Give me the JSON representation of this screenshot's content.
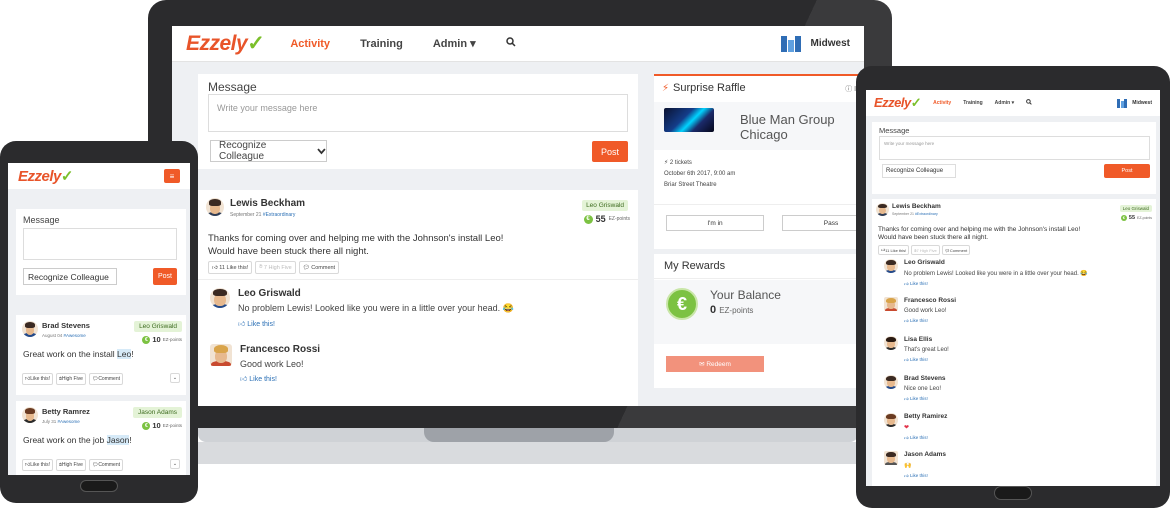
{
  "brand": {
    "logo": "Ezzely",
    "accent": "#f05a28",
    "green": "#7cc242"
  },
  "laptop": {
    "nav": {
      "items": [
        "Activity",
        "Training",
        "Admin ▾"
      ],
      "org": "Midwest"
    },
    "message": {
      "title": "Message",
      "placeholder": "Write your message here",
      "recognize": "Recognize Colleague",
      "post": "Post"
    },
    "post": {
      "author": "Lewis Beckham",
      "date": "September 21",
      "hashtag": "#Extraordinary",
      "recipient": "Leo Griswald",
      "points": "55",
      "points_unit": "EZ-points",
      "body_line1": "Thanks for coming over and helping me with the Johnson's install Leo!",
      "body_line2": "Would have been stuck there all night.",
      "actions": [
        "11 Like this!",
        "7 High Five",
        "Comment"
      ]
    },
    "replies": [
      {
        "name": "Leo Griswald",
        "text": "No problem Lewis! Looked like you were in a little over your head. 😂",
        "like": "Like this!"
      },
      {
        "name": "Francesco Rossi",
        "text": "Good work Leo!",
        "like": "Like this!"
      }
    ],
    "raffle": {
      "title": "Surprise Raffle",
      "info": "In",
      "event_line1": "Blue Man Group",
      "event_line2": "Chicago",
      "tickets": "2 tickets",
      "datetime": "October 6th 2017, 9:00 am",
      "venue": "Briar Street Theatre",
      "in_label": "I'm in",
      "pass_label": "Pass"
    },
    "rewards": {
      "title": "My Rewards",
      "balance_label": "Your Balance",
      "balance": "0",
      "unit": "EZ-points",
      "redeem": "Redeem"
    }
  },
  "phone": {
    "menu": "≡",
    "message": {
      "label": "Message",
      "recognize": "Recognize Colleague",
      "post": "Post"
    },
    "posts": [
      {
        "author": "Brad Stevens",
        "date": "August 04",
        "hashtag": "#Awesome",
        "recipient": "Leo Griswald",
        "points": "10",
        "points_unit": "EZ-points",
        "body_prefix": "Great work on the install ",
        "mention": "Leo",
        "body_suffix": "!",
        "actions": [
          "Like this!",
          "High Five",
          "Comment"
        ]
      },
      {
        "author": "Betty Ramrez",
        "date": "July 31",
        "hashtag": "#Awesome",
        "recipient": "Jason Adams",
        "points": "10",
        "points_unit": "EZ-points",
        "body_prefix": "Great work on the job ",
        "mention": "Jason",
        "body_suffix": "!",
        "actions": [
          "Like this!",
          "High Five",
          "Comment"
        ]
      }
    ]
  },
  "tablet": {
    "nav": {
      "items": [
        "Activity",
        "Training",
        "Admin ▾"
      ],
      "org": "Midwest"
    },
    "message": {
      "label": "Message",
      "placeholder": "Write your message here",
      "recognize": "Recognize Colleague",
      "post": "Post"
    },
    "post": {
      "author": "Lewis Beckham",
      "date": "September 21",
      "hashtag": "#Extraordinary",
      "recipient": "Leo Griswald",
      "points": "55",
      "points_unit": "EZ-points",
      "body_line1": "Thanks for coming over and helping me with the Johnson's install Leo!",
      "body_line2": "Would have been stuck there all night.",
      "actions": [
        "11 Like this!",
        "7 High Five",
        "Comment"
      ]
    },
    "replies": [
      {
        "name": "Leo Griswald",
        "text": "No problem Lewis! Looked like you were in a little over your head. 😂",
        "like": "Like this!"
      },
      {
        "name": "Francesco Rossi",
        "text": "Good work Leo!",
        "like": "Like this!"
      },
      {
        "name": "Lisa Ellis",
        "text": "That's great Leo!",
        "like": "Like this!"
      },
      {
        "name": "Brad Stevens",
        "text": "Nice one Leo!",
        "like": "Like this!"
      },
      {
        "name": "Betty Ramirez",
        "text": "❤",
        "like": "Like this!"
      },
      {
        "name": "Jason Adams",
        "text": "🙌",
        "like": "Like this!"
      }
    ]
  }
}
